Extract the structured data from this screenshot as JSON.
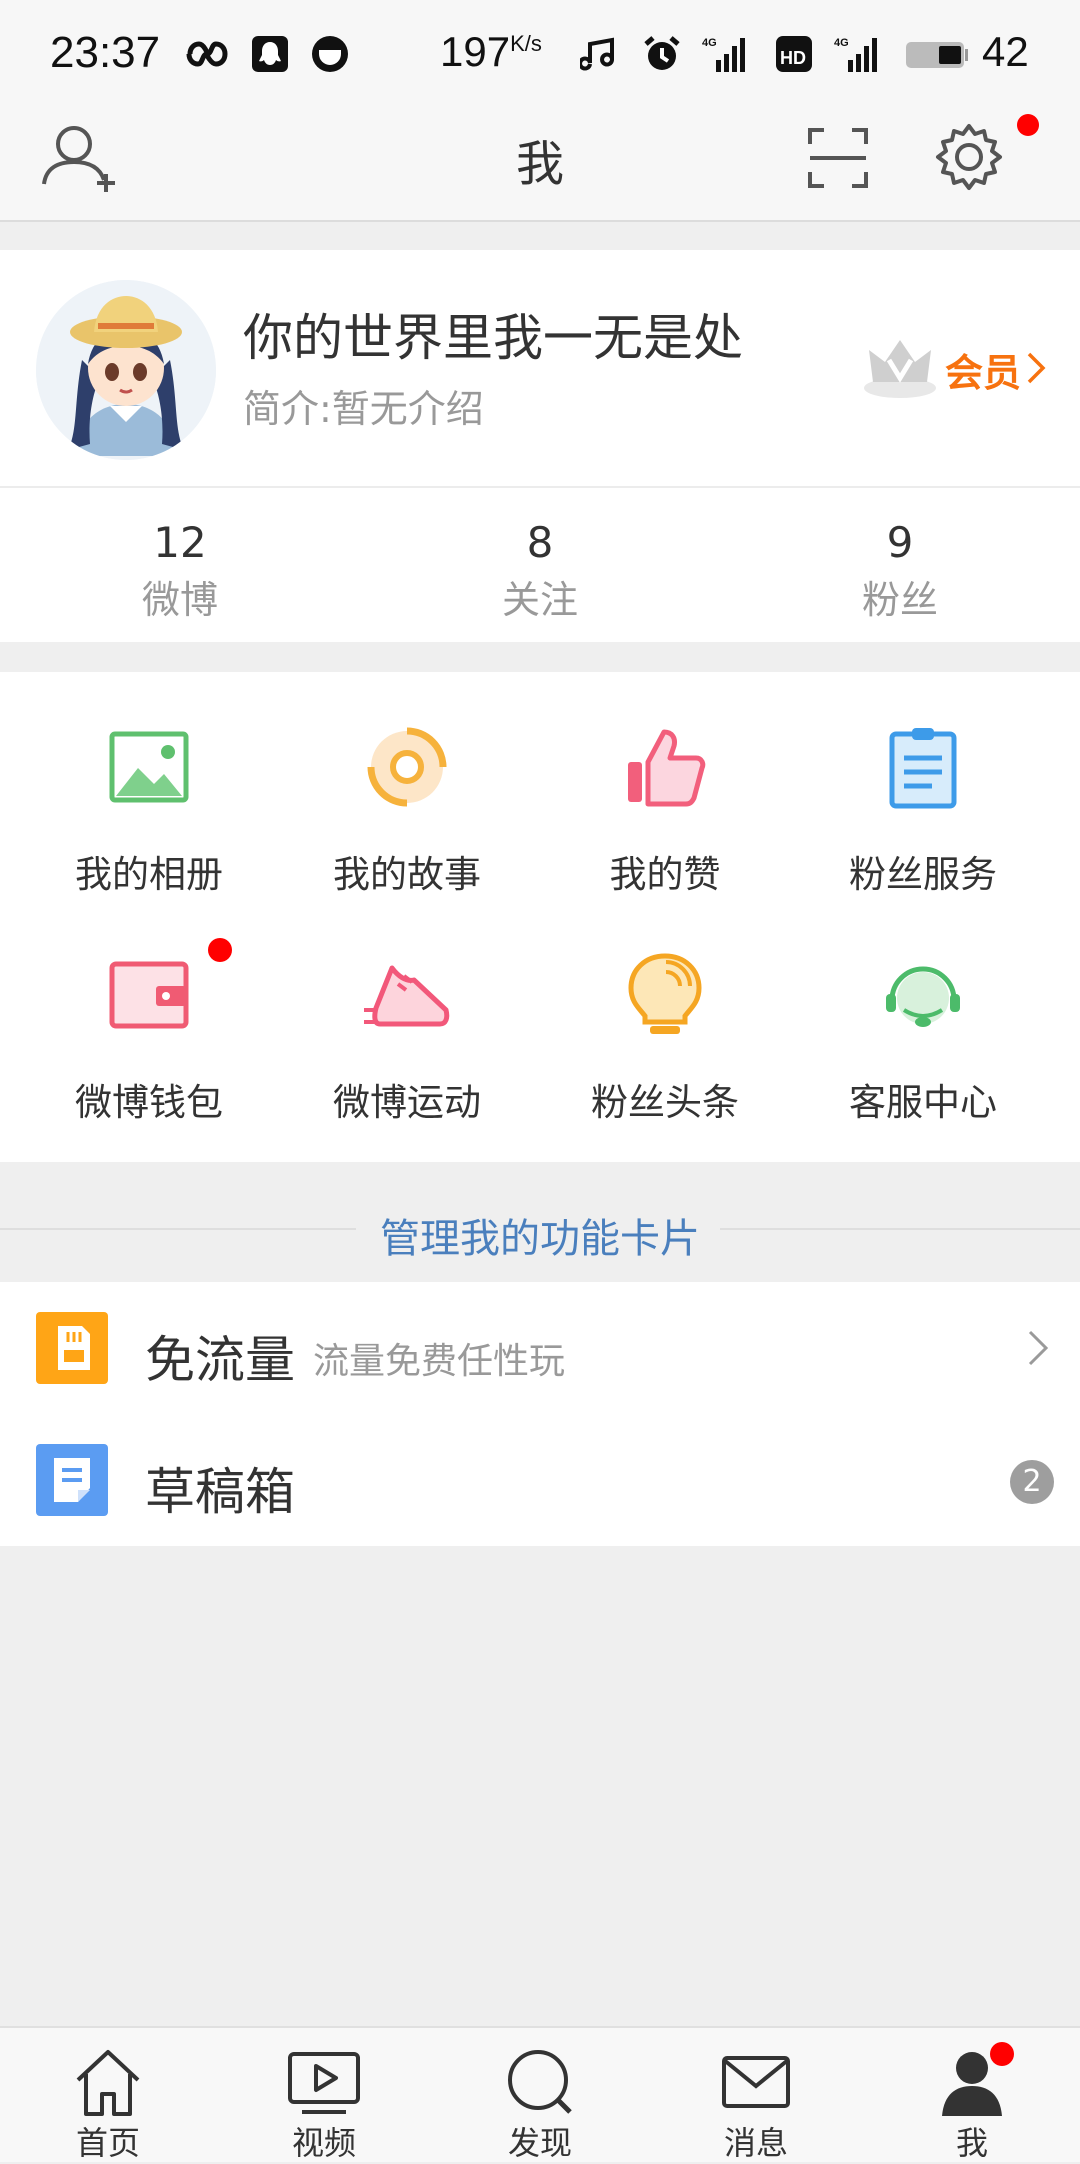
{
  "status_bar": {
    "time": "23:37",
    "speed_value": "197",
    "speed_unit": "K/s",
    "battery": "42"
  },
  "nav": {
    "title": "我",
    "icons": [
      "add-friend-icon",
      "scan-icon",
      "settings-icon"
    ]
  },
  "profile": {
    "username": "你的世界里我一无是处",
    "bio": "简介:暂无介绍",
    "vip_label": "会员"
  },
  "stats": [
    {
      "value": "12",
      "label": "微博"
    },
    {
      "value": "8",
      "label": "关注"
    },
    {
      "value": "9",
      "label": "粉丝"
    }
  ],
  "grid": [
    {
      "label": "我的相册",
      "icon": "album-icon"
    },
    {
      "label": "我的故事",
      "icon": "story-icon"
    },
    {
      "label": "我的赞",
      "icon": "like-icon"
    },
    {
      "label": "粉丝服务",
      "icon": "fan-service-icon"
    },
    {
      "label": "微博钱包",
      "icon": "wallet-icon"
    },
    {
      "label": "微博运动",
      "icon": "sport-shoe-icon"
    },
    {
      "label": "粉丝头条",
      "icon": "headline-bulb-icon"
    },
    {
      "label": "客服中心",
      "icon": "customer-service-icon"
    }
  ],
  "manage_cards": "管理我的功能卡片",
  "list": {
    "free_data": {
      "title": "免流量",
      "subtitle": "流量免费任性玩"
    },
    "drafts": {
      "title": "草稿箱",
      "badge": "2"
    }
  },
  "tabs": [
    {
      "label": "首页",
      "icon": "home-icon"
    },
    {
      "label": "视频",
      "icon": "video-icon"
    },
    {
      "label": "发现",
      "icon": "discover-icon"
    },
    {
      "label": "消息",
      "icon": "message-icon"
    },
    {
      "label": "我",
      "icon": "me-icon"
    }
  ],
  "colors": {
    "accent_orange": "#f7720f",
    "link_blue": "#4a7fbd",
    "red_dot": "#ff0000"
  }
}
